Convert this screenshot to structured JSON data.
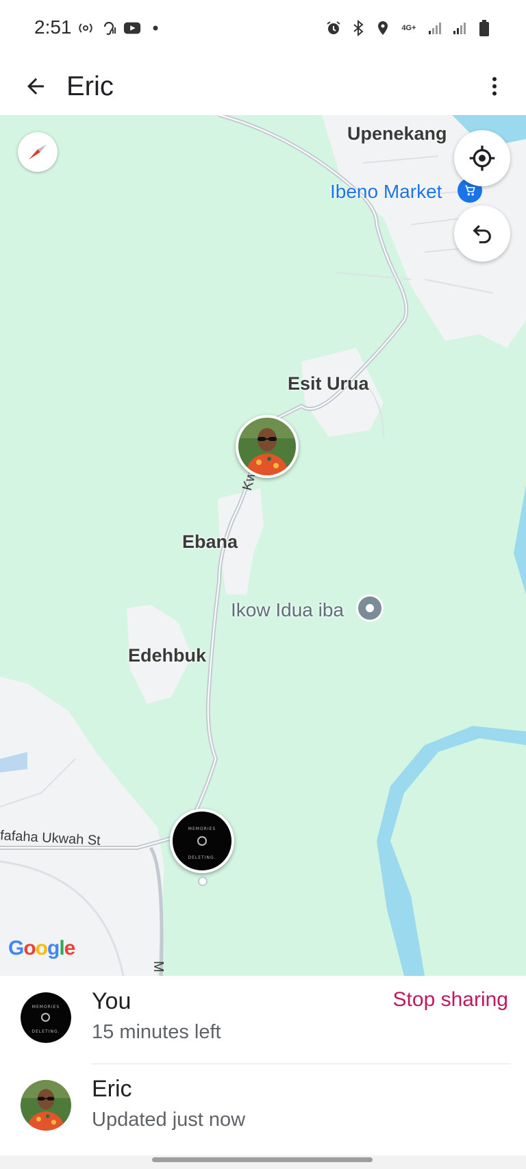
{
  "status_bar": {
    "time": "2:51",
    "left_icons": [
      "hotspot-icon",
      "hearing-icon",
      "youtube-icon",
      "dot-icon"
    ],
    "right_icons": [
      "alarm-icon",
      "bluetooth-icon",
      "location-icon",
      "network-4g-icon",
      "signal-icon",
      "signal-icon",
      "battery-icon"
    ],
    "network": "4G+"
  },
  "app_bar": {
    "title": "Eric",
    "back_icon": "arrow-back-icon",
    "menu_icon": "more-vert-icon"
  },
  "map": {
    "labels": {
      "upenekang": "Upenekang",
      "ibeno_market": "Ibeno Market",
      "esit_urua": "Esit Urua",
      "ebana": "Ebana",
      "ikow_idua_iba": "Ikow Idua iba",
      "edehbuk": "Edehbuk",
      "road_kwa_ibo": "Kwa Ibo",
      "road_ufaha": "fafaha Ukwah St",
      "road_m": "M"
    },
    "avatar_text": {
      "top": "MEMORIES",
      "bottom": "DELETING."
    },
    "controls": [
      "compass-icon",
      "my-location-icon",
      "recenter-icon"
    ],
    "attribution": "Google",
    "colors": {
      "land": "#d4f5e2",
      "urban": "#f1f3f4",
      "water": "#9ad9ee",
      "road": "#c3c9d1",
      "poi_blue": "#1a73e8"
    }
  },
  "sharing": {
    "you": {
      "name": "You",
      "status": "15 minutes left",
      "action": "Stop sharing"
    },
    "eric": {
      "name": "Eric",
      "status": "Updated just now"
    }
  }
}
